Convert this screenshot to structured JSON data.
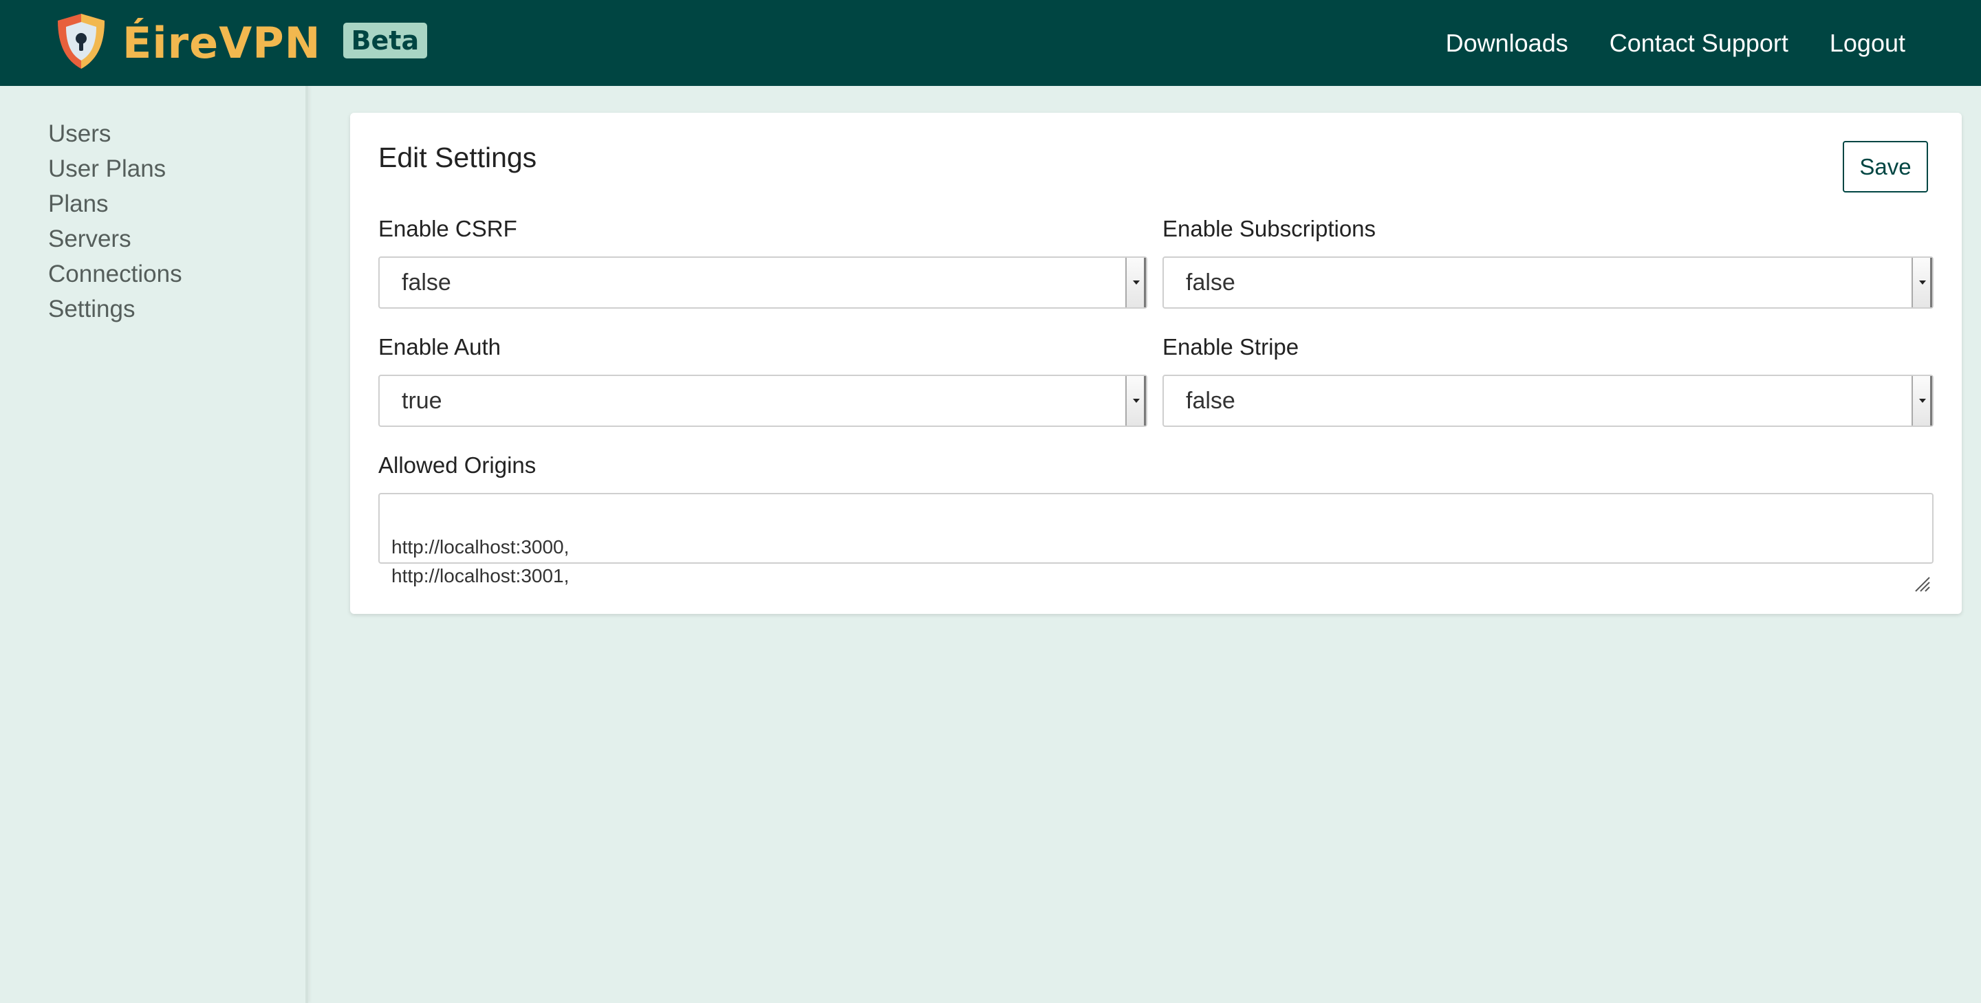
{
  "header": {
    "brand": "ÉireVPN",
    "badge": "Beta",
    "colors": {
      "nav_bg": "#004542",
      "brand_text": "#f2b84f",
      "badge_bg": "#a9d5c4",
      "page_bg": "#e3f0ec"
    },
    "links": [
      {
        "label": "Downloads"
      },
      {
        "label": "Contact Support"
      },
      {
        "label": "Logout"
      }
    ]
  },
  "sidebar": {
    "items": [
      {
        "label": "Users"
      },
      {
        "label": "User Plans"
      },
      {
        "label": "Plans"
      },
      {
        "label": "Servers"
      },
      {
        "label": "Connections"
      },
      {
        "label": "Settings"
      }
    ]
  },
  "settings": {
    "title": "Edit Settings",
    "save_label": "Save",
    "fields": {
      "csrf": {
        "label": "Enable CSRF",
        "value": "false"
      },
      "subscriptions": {
        "label": "Enable Subscriptions",
        "value": "false"
      },
      "auth": {
        "label": "Enable Auth",
        "value": "true"
      },
      "stripe": {
        "label": "Enable Stripe",
        "value": "false"
      }
    },
    "origins": {
      "label": "Allowed Origins",
      "value": "http://localhost:3000,\nhttp://localhost:3001,"
    }
  },
  "icons": {
    "logo": "shield-lock-icon",
    "select_caret": "caret-down-icon",
    "textarea_grip": "resize-grip-icon"
  }
}
